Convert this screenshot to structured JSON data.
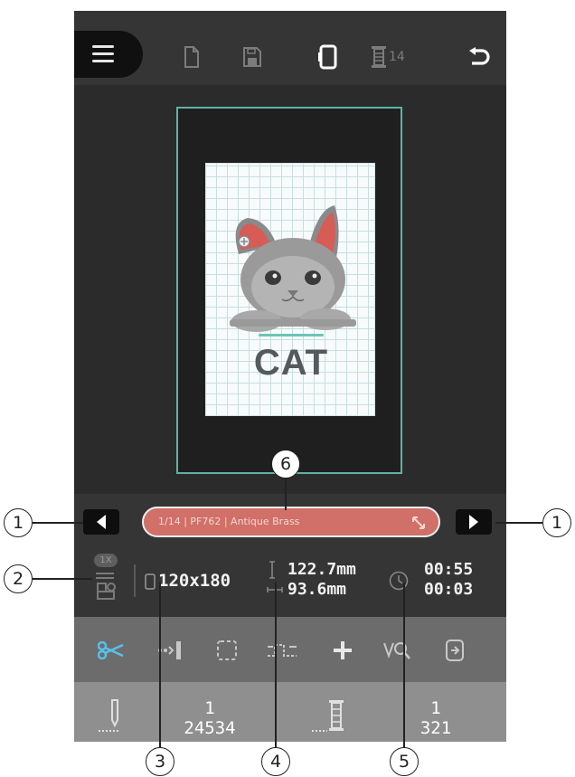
{
  "toolbar_top": {
    "menu_icon": "hamburger-icon",
    "new_icon": "new-file-icon",
    "save_icon": "save-icon",
    "hoop_icon": "hoop-icon",
    "thread_count": "14",
    "undo_icon": "undo-icon"
  },
  "canvas": {
    "design_text": "CAT"
  },
  "info": {
    "thread_label": "1/14 | PF762 | Antique Brass",
    "speed_badge": "1X",
    "hoop_size": "120x180",
    "height": "122.7mm",
    "width": "93.6mm",
    "time_total": "00:55",
    "time_remaining": "00:03"
  },
  "tools": [
    "scissors-icon",
    "move-stitch-icon",
    "select-area-icon",
    "jump-stitch-icon",
    "center-cross-icon",
    "zoom-icon",
    "hoop-export-icon"
  ],
  "counters": {
    "needle_color_index": "1",
    "needle_stitch_count": "24534",
    "thread_index": "1",
    "thread_stitch_count": "321"
  },
  "callouts": {
    "c1": "1",
    "c2": "2",
    "c3": "3",
    "c4": "4",
    "c5": "5",
    "c6": "6"
  },
  "colors": {
    "accent_teal": "#5fb2a6",
    "thread_pill": "#d07068",
    "screen_bg": "#2b2b2b"
  }
}
